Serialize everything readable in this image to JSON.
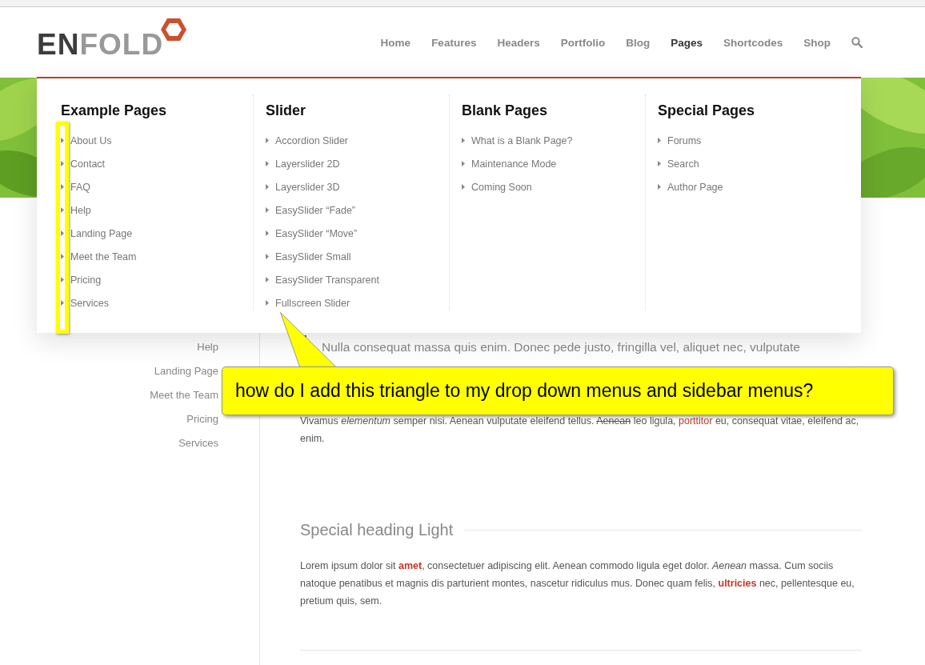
{
  "header": {
    "logo": [
      "EN",
      "FOLD"
    ],
    "nav": [
      {
        "label": "Home",
        "selected": false
      },
      {
        "label": "Features",
        "selected": false
      },
      {
        "label": "Headers",
        "selected": false
      },
      {
        "label": "Portfolio",
        "selected": false
      },
      {
        "label": "Blog",
        "selected": false
      },
      {
        "label": "Pages",
        "selected": true
      },
      {
        "label": "Shortcodes",
        "selected": false
      },
      {
        "label": "Shop",
        "selected": false
      }
    ]
  },
  "mega_menu": {
    "columns": [
      {
        "heading": "Example Pages",
        "items": [
          "About Us",
          "Contact",
          "FAQ",
          "Help",
          "Landing Page",
          "Meet the Team",
          "Pricing",
          "Services"
        ]
      },
      {
        "heading": "Slider",
        "items": [
          "Accordion Slider",
          "Layerslider 2D",
          "Layerslider 3D",
          "EasySlider “Fade”",
          "EasySlider “Move”",
          "EasySlider Small",
          "EasySlider Transparent",
          "Fullscreen Slider"
        ]
      },
      {
        "heading": "Blank Pages",
        "items": [
          "What is a Blank Page?",
          "Maintenance Mode",
          "Coming Soon"
        ]
      },
      {
        "heading": "Special Pages",
        "items": [
          "Forums",
          "Search",
          "Author Page"
        ]
      }
    ]
  },
  "sidebar": {
    "items": [
      "Help",
      "Landing Page",
      "Meet the Team",
      "Pricing",
      "Services"
    ]
  },
  "content": {
    "quote": "Nulla consequat massa quis enim. Donec pede justo, fringilla vel, aliquet nec, vulputate",
    "paragraph": [
      {
        "text": "Vivamus ",
        "kind": "plain"
      },
      {
        "text": "elementum",
        "kind": "italic"
      },
      {
        "text": " semper nisi. Aenean vulputate eleifend tellus. ",
        "kind": "plain"
      },
      {
        "text": "Aenean",
        "kind": "strike"
      },
      {
        "text": " leo ligula, ",
        "kind": "plain"
      },
      {
        "text": "porttitor",
        "kind": "link"
      },
      {
        "text": " eu, consequat vitae, eleifend ac, enim.",
        "kind": "plain"
      }
    ],
    "special_heading": "Special heading Light",
    "body": "Lorem ipsum dolor sit **amet**, consectetuer adipiscing elit. Aenean commodo ligula eget dolor. *Aenean* massa. Cum sociis natoque penatibus et magnis dis parturient montes, nascetur ridiculus mus. Donec quam felis, **ultricies** nec, pellentesque eu, pretium quis, sem."
  },
  "annotation": {
    "text": "how do I add this triangle to my drop down menus and sidebar menus?"
  }
}
